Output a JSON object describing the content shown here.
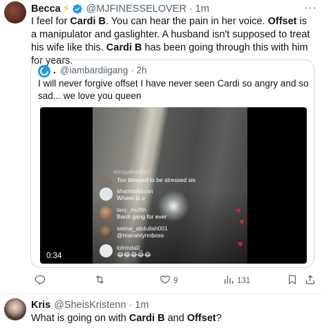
{
  "tweet": {
    "author_name": "Becca",
    "author_emoji": "⚡",
    "handle": "@MJFINESSELOVER",
    "time": "· 1m",
    "text": {
      "p1": "I feel for ",
      "b1": "Cardi B",
      "p2": ". You can hear the pain in her voice. ",
      "b2": "Offset",
      "p3": " is a manipulator and gaslighter. A husband isn't supposed to treat his wife like this. ",
      "b3": "Cardi B",
      "p4": " has been going through this with him for years."
    },
    "more": "···"
  },
  "quote": {
    "author_name": ".",
    "handle": "@iambardiigang",
    "time": "· 2h",
    "text": "I will never forgive offset I have never seen Cardi so angry and so sad... we love you queen",
    "video": {
      "duration": "0:34",
      "faded_user": "errogathedon",
      "comments": [
        {
          "user": "",
          "text": "Too blessed to be stressed sis"
        },
        {
          "user": "shamsshayan",
          "text": "Where is u"
        },
        {
          "user": "lavy_muffin",
          "text": "Bardi gang for ever"
        },
        {
          "user": "selma_abdullah001",
          "text": "@mariahlynnboss"
        },
        {
          "user": "lofrmda0_",
          "text": "😂😂😂😂😂"
        }
      ]
    }
  },
  "actions": {
    "reply": "",
    "retweet": "",
    "like": "9",
    "views": "131"
  },
  "reply_tweet": {
    "author_name": "Kris",
    "handle": "@SheisKristenn",
    "time": "· 1m",
    "text": {
      "p1": "What is going on with ",
      "b1": "Cardi B",
      "p2": " and ",
      "b2": "Offset",
      "p3": "?"
    }
  },
  "colors": {
    "lightning": "#f5a623",
    "verified": "#1d9bf0",
    "muted": "#536471",
    "heart": "#d9242f"
  },
  "icons": {
    "reply": "speech-bubble",
    "retweet": "retweet-arrows",
    "like": "heart-outline",
    "views": "bar-chart",
    "bookmark": "bookmark-outline",
    "share": "upload-arrow"
  }
}
